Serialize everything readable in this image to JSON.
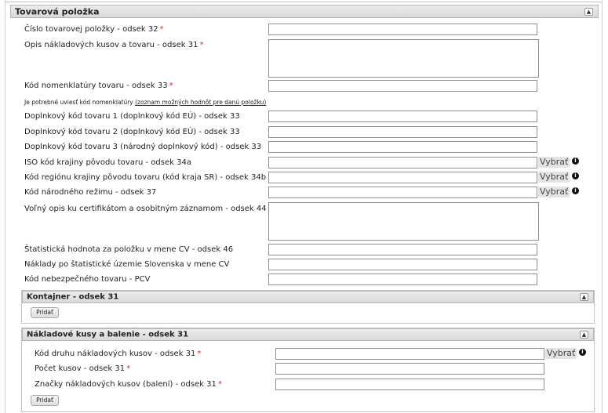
{
  "section": {
    "title": "Tovarová položka",
    "collapse_icon": "chevron-up-icon"
  },
  "fields": [
    {
      "label": "Číslo tovarovej položky - odsek 32",
      "required": true
    },
    {
      "label": "Opis nákladových kusov a tovaru - odsek 31",
      "required": true
    },
    {
      "label": "Kód nomenklatúry tovaru - odsek 33",
      "required": true
    },
    {
      "label": "Doplnkový kód tovaru 1 (doplnkový kód EÚ) - odsek 33",
      "required": false
    },
    {
      "label": "Doplnkový kód tovaru 2 (doplnkový kód EÚ) - odsek 33",
      "required": false
    },
    {
      "label": "Doplnkový kód tovaru 3 (národný doplnkový kód) - odsek 33",
      "required": false
    },
    {
      "label": "ISO kód krajiny pôvodu tovaru - odsek 34a",
      "required": false
    },
    {
      "label": "Kód regiónu krajiny pôvodu tovaru (kód kraja SR) - odsek 34b",
      "required": false
    },
    {
      "label": "Kód národného režimu - odsek 37",
      "required": false
    },
    {
      "label": "Voľný opis ku certifikátom a osobitným záznamom - odsek 44",
      "required": false
    },
    {
      "label": "Štatistická hodnota za položku v mene CV - odsek 46",
      "required": false
    },
    {
      "label": "Náklady po štatistické územie Slovenska v mene CV",
      "required": false
    },
    {
      "label": "Kód nebezpečného tovaru - PCV",
      "required": false
    }
  ],
  "note": {
    "text": "Je potrebné uviesť kód nomenklatúry ",
    "link": "(zoznam možných hodnôt pre danú položku)"
  },
  "required_mark": "*",
  "select_label": "Vybrať",
  "info_glyph": "i",
  "container": {
    "title": "Kontajner - odsek 31",
    "add_label": "Pridať"
  },
  "packages": {
    "title": "Nákladové kusy a balenie - odsek 31",
    "fields": [
      {
        "label": "Kód druhu nákladových kusov - odsek 31",
        "required": true
      },
      {
        "label": "Počet kusov - odsek 31",
        "required": true
      },
      {
        "label": "Značky nákladových kusov (balení) - odsek 31",
        "required": true
      }
    ],
    "add_label": "Pridať"
  }
}
